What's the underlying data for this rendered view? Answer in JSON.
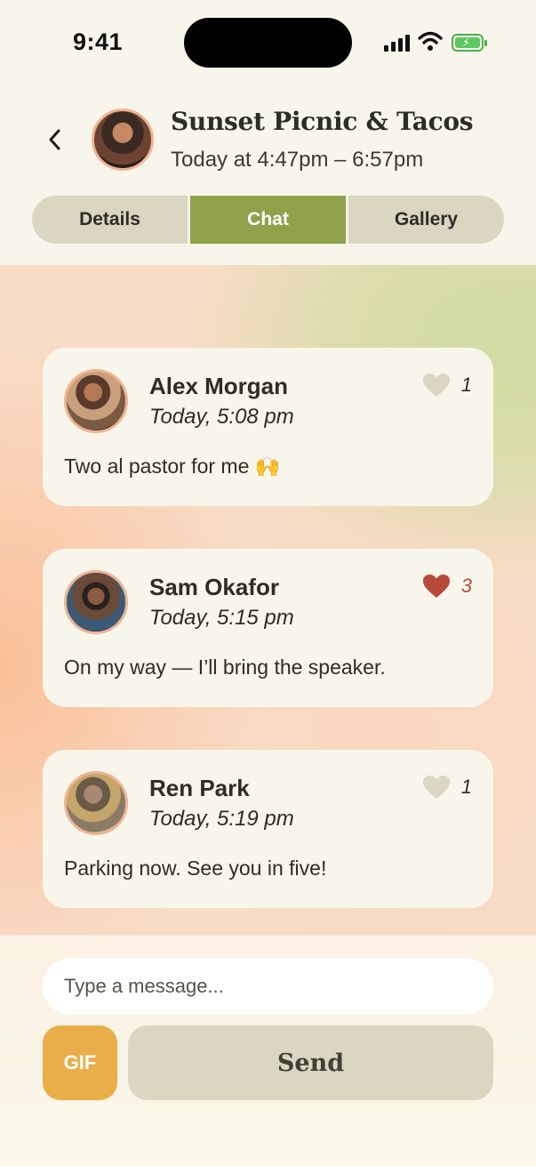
{
  "status_bar": {
    "time": "9:41"
  },
  "header": {
    "title": "Sunset Picnic & Tacos",
    "time_range": "Today at 4:47pm – 6:57pm",
    "tabs": [
      {
        "label": "Details",
        "active": false
      },
      {
        "label": "Chat",
        "active": true
      },
      {
        "label": "Gallery",
        "active": false
      }
    ]
  },
  "messages": [
    {
      "name": "Alex Morgan",
      "timestamp": "Today, 5:08 pm",
      "text": "Two al pastor for me 🙌",
      "likes": "1",
      "liked": false
    },
    {
      "name": "Sam Okafor",
      "timestamp": "Today, 5:15 pm",
      "text": "On my way — I’ll bring the speaker.",
      "likes": "3",
      "liked": true
    },
    {
      "name": "Ren Park",
      "timestamp": "Today, 5:19 pm",
      "text": "Parking now. See you in five!",
      "likes": "1",
      "liked": false
    }
  ],
  "composer": {
    "placeholder": "Type a message...",
    "gif_label": "GIF",
    "send_label": "Send"
  },
  "colors": {
    "accent_green": "#8ea24c",
    "gif_orange": "#e9ae47",
    "liked_red": "#b84a3c",
    "unliked_heart": "#dbd6c2"
  },
  "icons": {
    "back": "chevron-left-icon",
    "like": "heart-icon",
    "signal": "cellular-signal-icon",
    "wifi": "wifi-icon",
    "battery": "battery-charging-icon"
  }
}
